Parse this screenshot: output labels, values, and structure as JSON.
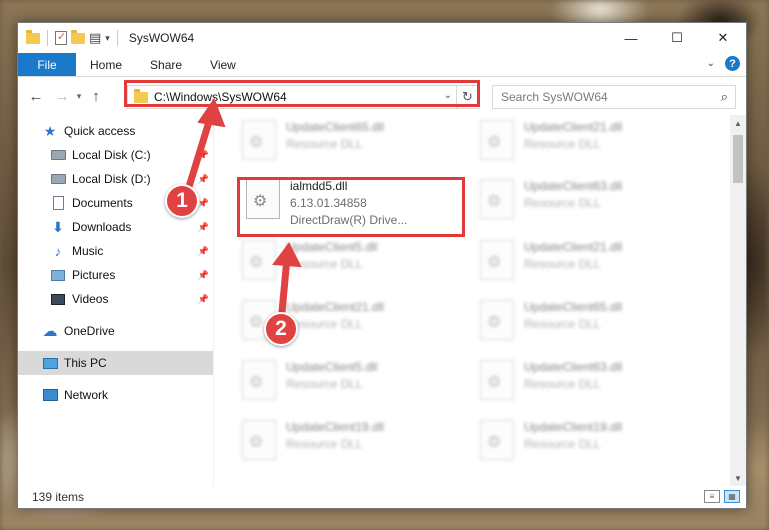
{
  "window": {
    "title": "SysWOW64",
    "minimize_glyph": "—",
    "maximize_glyph": "☐",
    "close_glyph": "✕"
  },
  "ribbon": {
    "tabs": [
      "File",
      "Home",
      "Share",
      "View"
    ],
    "help_glyph": "?"
  },
  "address_bar": {
    "path": "C:\\Windows\\SysWOW64",
    "search_placeholder": "Search SysWOW64"
  },
  "nav_pane": {
    "quick_access": "Quick access",
    "items": [
      {
        "label": "Local Disk (C:)",
        "icon": "drive-icon",
        "pinned": true
      },
      {
        "label": "Local Disk (D:)",
        "icon": "drive-icon",
        "pinned": true
      },
      {
        "label": "Documents",
        "icon": "documents-icon",
        "pinned": true
      },
      {
        "label": "Downloads",
        "icon": "downloads-icon",
        "pinned": true
      },
      {
        "label": "Music",
        "icon": "music-icon",
        "pinned": true
      },
      {
        "label": "Pictures",
        "icon": "pictures-icon",
        "pinned": true
      },
      {
        "label": "Videos",
        "icon": "videos-icon",
        "pinned": true
      }
    ],
    "onedrive": "OneDrive",
    "this_pc": "This PC",
    "network": "Network"
  },
  "files": [
    {
      "name": "UpdateClient65.dll",
      "meta1": "Resource DLL",
      "meta2": ""
    },
    {
      "name": "UpdateClient21.dll",
      "meta1": "Resource DLL",
      "meta2": ""
    },
    {
      "name": "ialmdd5.dll",
      "meta1": "6.13.01.34858",
      "meta2": "DirectDraw(R) Drive..."
    },
    {
      "name": "UpdateClient63.dll",
      "meta1": "Resource DLL",
      "meta2": ""
    },
    {
      "name": "UpdateClient5.dll",
      "meta1": "Resource DLL",
      "meta2": ""
    },
    {
      "name": "UpdateClient21.dll",
      "meta1": "Resource DLL",
      "meta2": ""
    },
    {
      "name": "UpdateClient21.dll",
      "meta1": "Resource DLL",
      "meta2": ""
    },
    {
      "name": "UpdateClient65.dll",
      "meta1": "Resource DLL",
      "meta2": ""
    },
    {
      "name": "UpdateClient5.dll",
      "meta1": "Resource DLL",
      "meta2": ""
    },
    {
      "name": "UpdateClient63.dll",
      "meta1": "Resource DLL",
      "meta2": ""
    },
    {
      "name": "UpdateClient19.dll",
      "meta1": "Resource DLL",
      "meta2": ""
    },
    {
      "name": "UpdateClient19.dll",
      "meta1": "Resource DLL",
      "meta2": ""
    }
  ],
  "status": {
    "item_count": "139 items"
  },
  "annotations": {
    "badge_1": "1",
    "badge_2": "2",
    "highlight_color": "#e03a3a"
  }
}
